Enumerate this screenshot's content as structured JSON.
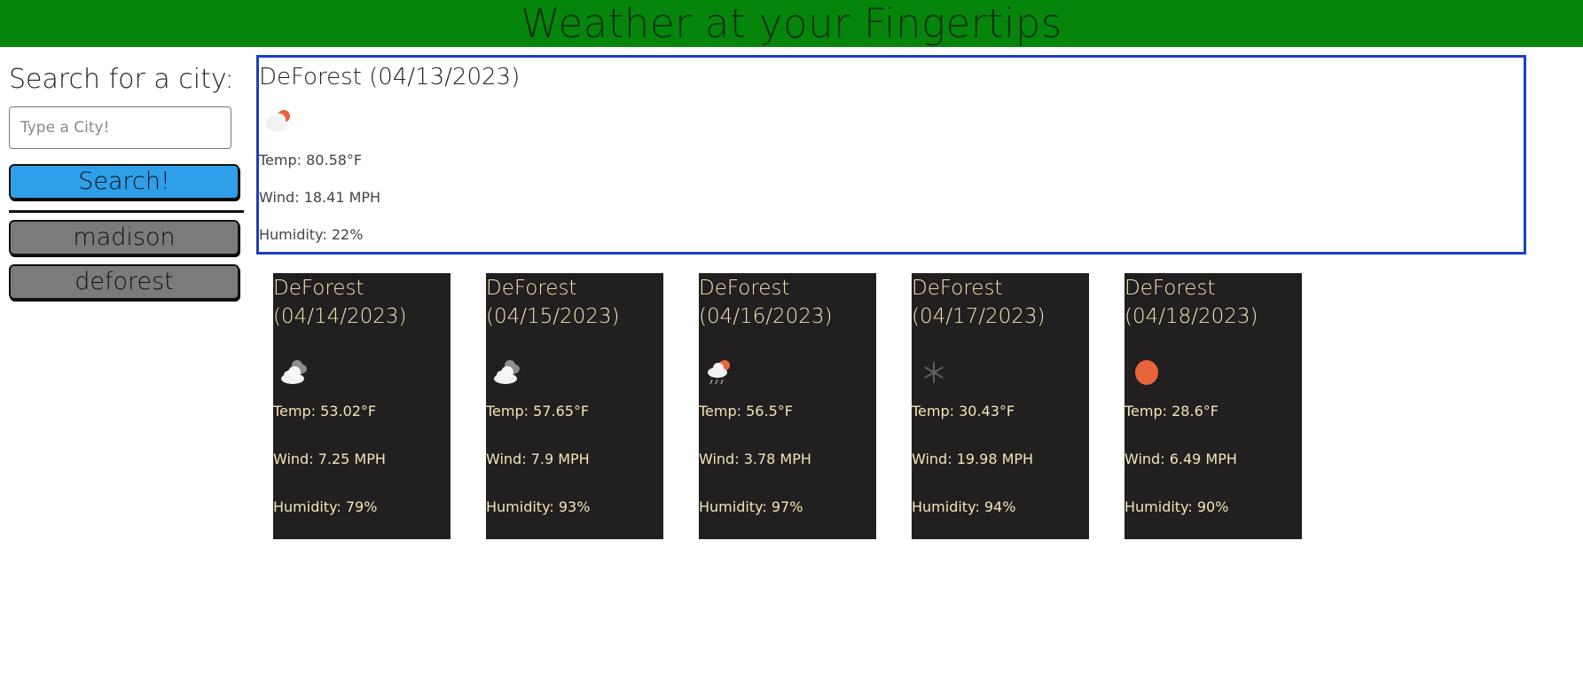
{
  "header": {
    "title": "Weather at your Fingertips"
  },
  "sidebar": {
    "search_title": "Search for a city:",
    "input_placeholder": "Type a City!",
    "input_value": "",
    "search_button": "Search!",
    "history": [
      "madison",
      "deforest"
    ]
  },
  "current": {
    "title": "DeForest (04/13/2023)",
    "icon": "partly-cloudy-day-icon",
    "temp": "Temp: 80.58°F",
    "wind": "Wind: 18.41 MPH",
    "humidity": "Humidity: 22%"
  },
  "forecast": [
    {
      "city": "DeForest",
      "date": "(04/14/2023)",
      "icon": "broken-clouds-icon",
      "temp": "Temp: 53.02°F",
      "wind": "Wind: 7.25 MPH",
      "humidity": "Humidity: 79%"
    },
    {
      "city": "DeForest",
      "date": "(04/15/2023)",
      "icon": "broken-clouds-icon",
      "temp": "Temp: 57.65°F",
      "wind": "Wind: 7.9 MPH",
      "humidity": "Humidity: 93%"
    },
    {
      "city": "DeForest",
      "date": "(04/16/2023)",
      "icon": "rain-icon",
      "temp": "Temp: 56.5°F",
      "wind": "Wind: 3.78 MPH",
      "humidity": "Humidity: 97%"
    },
    {
      "city": "DeForest",
      "date": "(04/17/2023)",
      "icon": "snow-icon",
      "temp": "Temp: 30.43°F",
      "wind": "Wind: 19.98 MPH",
      "humidity": "Humidity: 94%"
    },
    {
      "city": "DeForest",
      "date": "(04/18/2023)",
      "icon": "clear-sun-icon",
      "temp": "Temp: 28.6°F",
      "wind": "Wind: 6.49 MPH",
      "humidity": "Humidity: 90%"
    }
  ],
  "colors": {
    "header_bg": "#06850b",
    "search_button": "#2e9fe8",
    "history_button": "#7b7b7b",
    "current_border": "#1c3fc4",
    "card_bg": "#211f1f",
    "card_text": "#f3e4b8",
    "sun": "#e8643c"
  }
}
